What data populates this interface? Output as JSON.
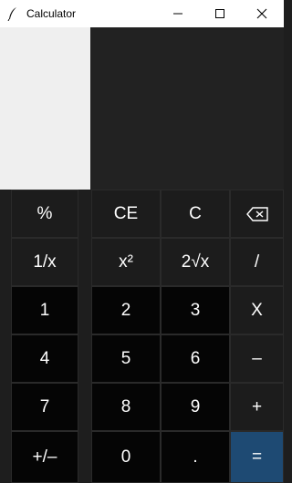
{
  "window": {
    "title": "Calculator",
    "app_icon": "feather-icon",
    "controls": [
      "minimize-icon",
      "maximize-icon",
      "close-icon"
    ]
  },
  "keypad": {
    "row1": [
      "%",
      "CE",
      "C",
      "⌫"
    ],
    "row2": [
      "1/x",
      "x²",
      "2√x",
      "/"
    ],
    "row3": [
      "1",
      "2",
      "3",
      "X"
    ],
    "row4": [
      "4",
      "5",
      "6",
      "–"
    ],
    "row5": [
      "7",
      "8",
      "9",
      "+"
    ],
    "row6": [
      "+/–",
      "0",
      ".",
      "="
    ]
  },
  "colors": {
    "function_key": "#1c1c1c",
    "digit_key": "#050505",
    "equals_key": "#1e4a73",
    "display_left": "#efefef",
    "display_right": "#222222"
  }
}
